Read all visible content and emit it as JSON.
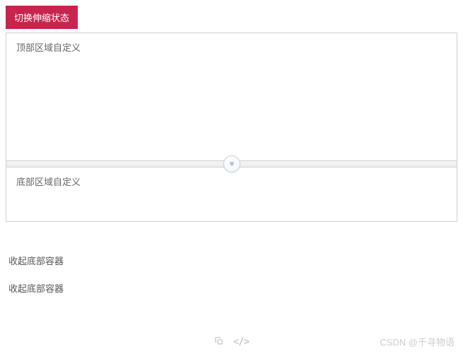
{
  "toggle_button": {
    "label": "切换伸缩状态"
  },
  "panels": {
    "top": {
      "text": "顶部区域自定义"
    },
    "bottom": {
      "text": "底部区域自定义"
    }
  },
  "splitter": {
    "icon": "chevron-down"
  },
  "links": [
    {
      "label": "收起底部容器"
    },
    {
      "label": "收起底部容器"
    }
  ],
  "footer": {
    "copy_icon": "copy",
    "code_icon": "code",
    "watermark": "CSDN @千寻物语"
  }
}
